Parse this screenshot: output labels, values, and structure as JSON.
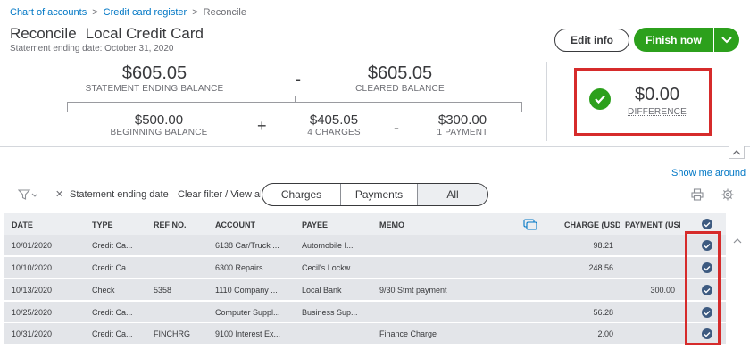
{
  "breadcrumb": {
    "chart_of_accounts": "Chart of accounts",
    "sep1": ">",
    "credit_card_register": "Credit card register",
    "sep2": ">",
    "current": "Reconcile"
  },
  "header": {
    "title": "Reconcile",
    "account": "Local Credit Card",
    "statement_date": "Statement ending date: October 31, 2020",
    "edit_info_label": "Edit info",
    "finish_now_label": "Finish now"
  },
  "summary": {
    "statement_ending_balance": "$605.05",
    "statement_ending_balance_label": "STATEMENT ENDING BALANCE",
    "minus1": "-",
    "cleared_balance": "$605.05",
    "cleared_balance_label": "CLEARED BALANCE",
    "beginning_balance": "$500.00",
    "beginning_balance_label": "BEGINNING BALANCE",
    "plus": "+",
    "charges": "$405.05",
    "charges_label": "4 CHARGES",
    "minus2": "-",
    "payments": "$300.00",
    "payments_label": "1 PAYMENT",
    "difference": "$0.00",
    "difference_label": "DIFFERENCE"
  },
  "show_me_around": "Show me around",
  "filter": {
    "applied": "Statement ending date",
    "clear": "Clear filter / View all",
    "tabs": [
      "Charges",
      "Payments",
      "All"
    ],
    "active_tab": "All"
  },
  "table": {
    "columns": [
      "DATE",
      "TYPE",
      "REF NO.",
      "ACCOUNT",
      "PAYEE",
      "MEMO",
      "CHARGE (USD)",
      "PAYMENT (USD)"
    ],
    "rows": [
      {
        "date": "10/01/2020",
        "type": "Credit Ca...",
        "ref": "",
        "account": "6138 Car/Truck ...",
        "payee": "Automobile I...",
        "memo": "",
        "charge": "98.21",
        "payment": ""
      },
      {
        "date": "10/10/2020",
        "type": "Credit Ca...",
        "ref": "",
        "account": "6300 Repairs",
        "payee": "Cecil's Lockw...",
        "memo": "",
        "charge": "248.56",
        "payment": ""
      },
      {
        "date": "10/13/2020",
        "type": "Check",
        "ref": "5358",
        "account": "1110 Company ...",
        "payee": "Local Bank",
        "memo": "9/30 Stmt payment",
        "charge": "",
        "payment": "300.00"
      },
      {
        "date": "10/25/2020",
        "type": "Credit Ca...",
        "ref": "",
        "account": "Computer Suppl...",
        "payee": "Business Sup...",
        "memo": "",
        "charge": "56.28",
        "payment": ""
      },
      {
        "date": "10/31/2020",
        "type": "Credit Ca...",
        "ref": "FINCHRG",
        "account": "9100 Interest Ex...",
        "payee": "",
        "memo": "Finance Charge",
        "charge": "2.00",
        "payment": ""
      }
    ]
  },
  "colors": {
    "brand_green": "#2ca01c",
    "link_blue": "#0077c5",
    "highlight_red": "#d62b2b",
    "check_navy": "#3d5a80"
  },
  "icons": [
    "filter-icon",
    "close-icon",
    "print-icon",
    "gear-icon",
    "columns-icon",
    "check-icon",
    "chevron-down-icon",
    "chevron-up-icon"
  ]
}
